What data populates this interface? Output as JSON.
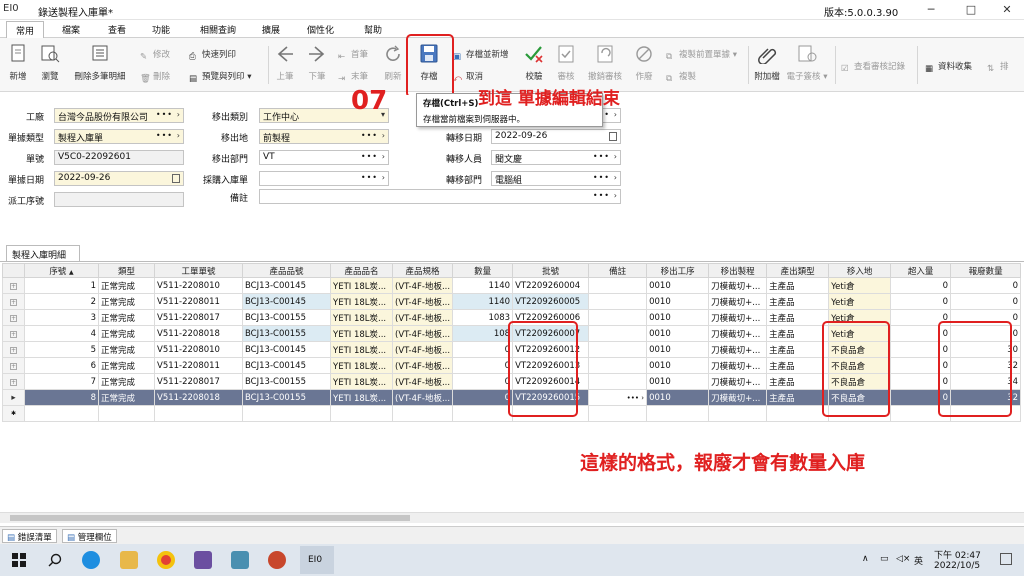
{
  "window": {
    "logo": "EI0",
    "title": "錄送製程入庫單*",
    "version": "版本:5.0.0.3.90",
    "minimize": "─",
    "maximize": "□",
    "close": "✕"
  },
  "menu": [
    "常用",
    "檔案",
    "查看",
    "功能",
    "相關查詢",
    "擴展",
    "個性化",
    "幫助"
  ],
  "ribbon": {
    "new": "新增",
    "browse": "瀏覽",
    "delete_detail": "刪除多筆明細",
    "modify": "修改",
    "delete": "刪除",
    "quick_print": "快速列印",
    "preview_print": "預覽與列印",
    "prev": "上筆",
    "next": "下筆",
    "first": "首筆",
    "last": "末筆",
    "refresh": "刷新",
    "save": "存檔",
    "save_new": "存檔並新增",
    "cancel": "取消",
    "validate": "校驗",
    "review": "審核",
    "unreview": "撤銷審核",
    "void": "作廢",
    "copy_prev": "複製前置單據",
    "copy": "複製",
    "attach": "附加檔",
    "esign": "電子簽核",
    "view_review": "查看審核記錄",
    "collect": "資料收集",
    "sort": "排"
  },
  "tooltip": {
    "title": "存檔(Ctrl+S)",
    "desc": "存檔當前檔案到伺服器中。"
  },
  "annotations": {
    "step": "07",
    "step_text": "到這 單據編輯結束",
    "note": "這樣的格式，報廢才會有數量入庫"
  },
  "form": {
    "factory_label": "工廠",
    "factory_value": "台灣今品股份有限公司",
    "doc_type_label": "單據類型",
    "doc_type_value": "製程入庫單",
    "doc_no_label": "單號",
    "doc_no_value": "V5C0-22092601",
    "doc_date_label": "單據日期",
    "doc_date_value": "2022-09-26",
    "src_label": "派工序號",
    "src_value": "",
    "out_type_label": "移出類別",
    "out_type_value": "工作中心",
    "out_place_label": "移出地",
    "out_place_value": "前製程",
    "out_dept_label": "移出部門",
    "out_dept_value": "VT",
    "purchase_label": "採購入庫單",
    "purchase_value": "",
    "memo_label": "備註",
    "memo_value": "",
    "transfer_date_label": "轉移日期",
    "transfer_date_value": "2022-09-26",
    "transfer_person_label": "轉移人員",
    "transfer_person_value": "聞文慶",
    "transfer_dept_label": "轉移部門",
    "transfer_dept_value": "電腦組"
  },
  "detail": {
    "tab": "製程入庫明細",
    "columns": [
      "序號",
      "類型",
      "工單單號",
      "產品品號",
      "產品品名",
      "產品規格",
      "數量",
      "批號",
      "備註",
      "移出工序",
      "移出製程",
      "產出類型",
      "移入地",
      "超入量",
      "報廢數量"
    ],
    "rows": [
      {
        "seq": "1",
        "type": "正常完成",
        "wo": "V511-2208010",
        "part": "BCJ13-C00145",
        "name": "YETI 18L炭...",
        "spec": "(VT-4F-地板...",
        "qty": "1140",
        "lot": "VT2209260004",
        "memo": "",
        "op": "0010",
        "proc": "刀模截切+...",
        "out": "主產品",
        "to": "Yeti倉",
        "over": "0",
        "scrap": "0"
      },
      {
        "seq": "2",
        "type": "正常完成",
        "wo": "V511-2208011",
        "part": "BCJ13-C00145",
        "name": "YETI 18L炭...",
        "spec": "(VT-4F-地板...",
        "qty": "1140",
        "lot": "VT2209260005",
        "memo": "",
        "op": "0010",
        "proc": "刀模截切+...",
        "out": "主產品",
        "to": "Yeti倉",
        "over": "0",
        "scrap": "0"
      },
      {
        "seq": "3",
        "type": "正常完成",
        "wo": "V511-2208017",
        "part": "BCJ13-C00155",
        "name": "YETI 18L炭...",
        "spec": "(VT-4F-地板...",
        "qty": "1083",
        "lot": "VT2209260006",
        "memo": "",
        "op": "0010",
        "proc": "刀模截切+...",
        "out": "主產品",
        "to": "Yeti倉",
        "over": "0",
        "scrap": "0"
      },
      {
        "seq": "4",
        "type": "正常完成",
        "wo": "V511-2208018",
        "part": "BCJ13-C00155",
        "name": "YETI 18L炭...",
        "spec": "(VT-4F-地板...",
        "qty": "108",
        "lot": "VT2209260007",
        "memo": "",
        "op": "0010",
        "proc": "刀模截切+...",
        "out": "主產品",
        "to": "Yeti倉",
        "over": "0",
        "scrap": "0"
      },
      {
        "seq": "5",
        "type": "正常完成",
        "wo": "V511-2208010",
        "part": "BCJ13-C00145",
        "name": "YETI 18L炭...",
        "spec": "(VT-4F-地板...",
        "qty": "0",
        "lot": "VT2209260012",
        "memo": "",
        "op": "0010",
        "proc": "刀模截切+...",
        "out": "主產品",
        "to": "不良品倉",
        "over": "0",
        "scrap": "30"
      },
      {
        "seq": "6",
        "type": "正常完成",
        "wo": "V511-2208011",
        "part": "BCJ13-C00145",
        "name": "YETI 18L炭...",
        "spec": "(VT-4F-地板...",
        "qty": "0",
        "lot": "VT2209260013",
        "memo": "",
        "op": "0010",
        "proc": "刀模截切+...",
        "out": "主產品",
        "to": "不良品倉",
        "over": "0",
        "scrap": "32"
      },
      {
        "seq": "7",
        "type": "正常完成",
        "wo": "V511-2208017",
        "part": "BCJ13-C00155",
        "name": "YETI 18L炭...",
        "spec": "(VT-4F-地板...",
        "qty": "0",
        "lot": "VT2209260014",
        "memo": "",
        "op": "0010",
        "proc": "刀模截切+...",
        "out": "主產品",
        "to": "不良品倉",
        "over": "0",
        "scrap": "34"
      },
      {
        "seq": "8",
        "type": "正常完成",
        "wo": "V511-2208018",
        "part": "BCJ13-C00155",
        "name": "YETI 18L炭...",
        "spec": "(VT-4F-地板...",
        "qty": "0",
        "lot": "VT2209260015",
        "memo": "",
        "op": "0010",
        "proc": "刀模截切+...",
        "out": "主產品",
        "to": "不良品倉",
        "over": "0",
        "scrap": "32"
      }
    ]
  },
  "bottom_tabs": [
    "錯誤清單",
    "管理欄位"
  ],
  "taskbar": {
    "ime": "英",
    "time": "下午 02:47",
    "date": "2022/10/5",
    "app_label": "EI0"
  },
  "colors": {
    "annotation_red": "#e02020",
    "required_field": "#fbf6dc",
    "selected_row": "#6a7694",
    "alt_row": "#dcebf3"
  }
}
